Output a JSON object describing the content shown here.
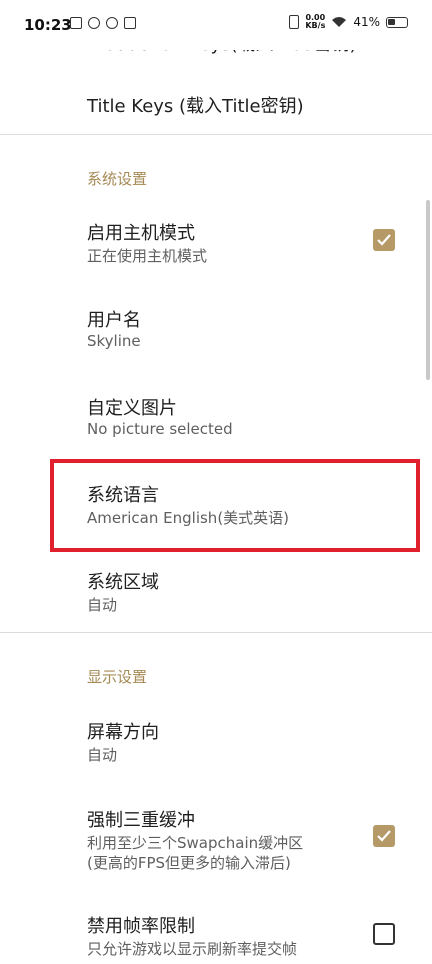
{
  "status_bar": {
    "time": "10:23",
    "speed_value": "0.00",
    "speed_unit": "KB/s",
    "battery": "41%"
  },
  "top_partial_item": {
    "title": "Production Keys(载入Prod密钥)"
  },
  "key_items": [
    {
      "title": "Title Keys (载入Title密钥)"
    }
  ],
  "system_section": {
    "header": "系统设置",
    "items": [
      {
        "title": "启用主机模式",
        "subtitle": "正在使用主机模式",
        "checked": true
      },
      {
        "title": "用户名",
        "subtitle": "Skyline"
      },
      {
        "title": "自定义图片",
        "subtitle": "No picture selected"
      },
      {
        "title": "系统语言",
        "subtitle": "American English(美式英语)"
      },
      {
        "title": "系统区域",
        "subtitle": "自动"
      }
    ]
  },
  "display_section": {
    "header": "显示设置",
    "items": [
      {
        "title": "屏幕方向",
        "subtitle": "自动"
      },
      {
        "title": "强制三重缓冲",
        "subtitle_line1": "利用至少三个Swapchain缓冲区",
        "subtitle_line2": "(更高的FPS但更多的输入滞后)",
        "checked": true
      },
      {
        "title": "禁用帧率限制",
        "subtitle": "只允许游戏以显示刷新率提交帧",
        "checked": false
      }
    ]
  },
  "colors": {
    "accent": "#b59a67",
    "highlight": "#e0202c",
    "section_header": "#a58a55"
  }
}
